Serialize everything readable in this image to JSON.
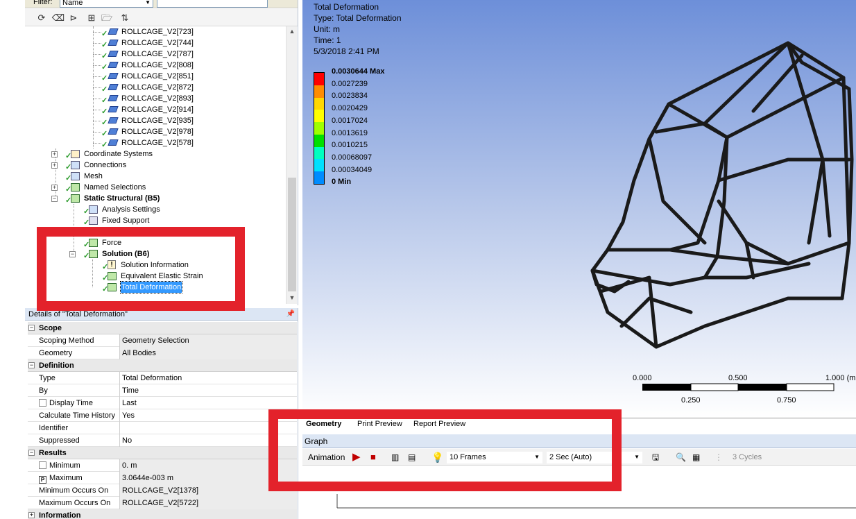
{
  "filter": {
    "label": "Filter:",
    "value": "Name"
  },
  "tree": {
    "bodies": [
      "ROLLCAGE_V2[723]",
      "ROLLCAGE_V2[744]",
      "ROLLCAGE_V2[787]",
      "ROLLCAGE_V2[808]",
      "ROLLCAGE_V2[851]",
      "ROLLCAGE_V2[872]",
      "ROLLCAGE_V2[893]",
      "ROLLCAGE_V2[914]",
      "ROLLCAGE_V2[935]",
      "ROLLCAGE_V2[978]",
      "ROLLCAGE_V2[578]"
    ],
    "coordinate_systems": "Coordinate Systems",
    "connections": "Connections",
    "mesh": "Mesh",
    "named_selections": "Named Selections",
    "static_structural": "Static Structural (B5)",
    "analysis_settings": "Analysis Settings",
    "fixed_support": "Fixed Support",
    "force": "Force",
    "solution": "Solution (B6)",
    "solution_information": "Solution Information",
    "equivalent_elastic_strain": "Equivalent Elastic Strain",
    "total_deformation": "Total Deformation"
  },
  "details": {
    "title": "Details of \"Total Deformation\"",
    "groups": {
      "scope": "Scope",
      "definition": "Definition",
      "results": "Results",
      "information": "Information"
    },
    "rows": {
      "scoping_method": {
        "k": "Scoping Method",
        "v": "Geometry Selection"
      },
      "geometry": {
        "k": "Geometry",
        "v": "All Bodies"
      },
      "type": {
        "k": "Type",
        "v": "Total Deformation"
      },
      "by": {
        "k": "By",
        "v": "Time"
      },
      "display_time": {
        "k": "Display Time",
        "v": "Last"
      },
      "calc_time_history": {
        "k": "Calculate Time History",
        "v": "Yes"
      },
      "identifier": {
        "k": "Identifier",
        "v": ""
      },
      "suppressed": {
        "k": "Suppressed",
        "v": "No"
      },
      "minimum": {
        "k": "Minimum",
        "v": "0. m"
      },
      "maximum": {
        "k": "Maximum",
        "v": "3.0644e-003 m"
      },
      "min_occurs": {
        "k": "Minimum Occurs On",
        "v": "ROLLCAGE_V2[1378]"
      },
      "max_occurs": {
        "k": "Maximum Occurs On",
        "v": "ROLLCAGE_V2[5722]"
      }
    },
    "p_marker": "P"
  },
  "viewport": {
    "info": [
      "Total Deformation",
      "Type: Total Deformation",
      "Unit: m",
      "Time: 1",
      "5/3/2018 2:41 PM"
    ],
    "legend": [
      {
        "label": "0.0030644 Max",
        "color": "#ff0000"
      },
      {
        "label": "0.0027239",
        "color": "#ff8c00"
      },
      {
        "label": "0.0023834",
        "color": "#ffd700"
      },
      {
        "label": "0.0020429",
        "color": "#ffff00"
      },
      {
        "label": "0.0017024",
        "color": "#a0ff00"
      },
      {
        "label": "0.0013619",
        "color": "#00e000"
      },
      {
        "label": "0.0010215",
        "color": "#00ffc0"
      },
      {
        "label": "0.00068097",
        "color": "#00e0ff"
      },
      {
        "label": "0.00034049",
        "color": "#008cff"
      },
      {
        "label": "0 Min",
        "color": "#0000ff"
      }
    ],
    "scale": {
      "t0": "0.000",
      "t1": "0.500",
      "t2": "1.000 (m",
      "b0": "0.250",
      "b1": "0.750"
    }
  },
  "view_tabs": [
    "Geometry",
    "Print Preview",
    "Report Preview"
  ],
  "graph": {
    "title": "Graph",
    "animation_label": "Animation",
    "frames": "10 Frames",
    "duration": "2 Sec (Auto)",
    "cycles": "3 Cycles"
  },
  "colors": {
    "highlight": "#e3222b",
    "selection": "#3399ff"
  }
}
